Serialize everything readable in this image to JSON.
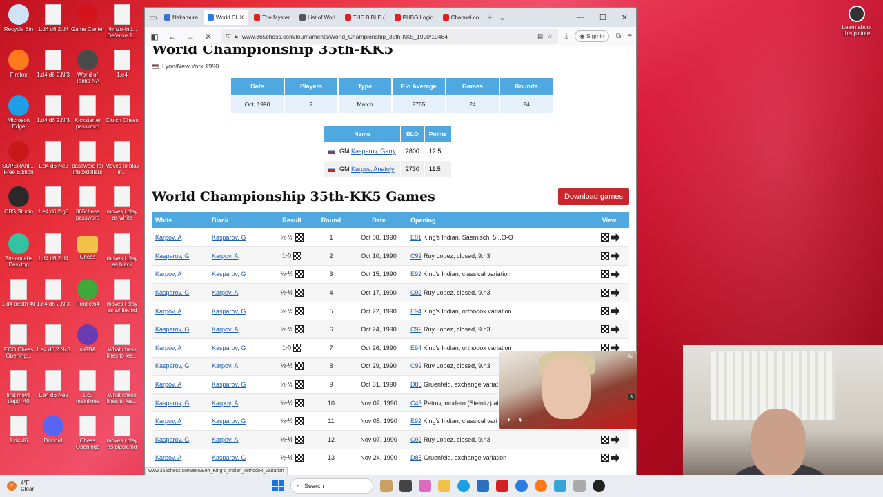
{
  "desktop": {
    "icons": [
      {
        "label": "Recycle Bin",
        "icon": "recycle-bin-icon",
        "color": "#cfe3f5"
      },
      {
        "label": "1.d4 d6 2.d4",
        "icon": "document-icon"
      },
      {
        "label": "Game Center",
        "icon": "game-center-icon",
        "color": "#d4141c"
      },
      {
        "label": "Nimzo-Ind... Defense 1...",
        "icon": "document-icon"
      },
      {
        "label": "Firefox",
        "icon": "firefox-icon",
        "color": "#ff7a1a"
      },
      {
        "label": "1.d4 d6 2.Nf3",
        "icon": "document-icon"
      },
      {
        "label": "World of Tanks NA",
        "icon": "world-of-tanks-icon",
        "color": "#4a4a4a"
      },
      {
        "label": "1.e4",
        "icon": "document-icon"
      },
      {
        "label": "Microsoft Edge",
        "icon": "edge-icon",
        "color": "#1e9ee6"
      },
      {
        "label": "1.d4 d6 2.Nf3",
        "icon": "document-icon"
      },
      {
        "label": "Kickstarter password",
        "icon": "document-icon"
      },
      {
        "label": "Clutch Chess",
        "icon": "document-icon"
      },
      {
        "label": "SUPERAnti... Free Edition",
        "icon": "superantispyware-icon",
        "color": "#c81818"
      },
      {
        "label": "1.d4 d6 Ne2",
        "icon": "document-icon"
      },
      {
        "label": "password for inboxdollars",
        "icon": "document-icon"
      },
      {
        "label": "Moves to play in...",
        "icon": "document-icon"
      },
      {
        "label": "OBS Studio",
        "icon": "obs-icon",
        "color": "#2a2a2a"
      },
      {
        "label": "1.e4 d6 2.g3",
        "icon": "document-icon"
      },
      {
        "label": "365chess password",
        "icon": "document-icon"
      },
      {
        "label": "moves i play as white",
        "icon": "document-icon"
      },
      {
        "label": "Streamlabs Desktop",
        "icon": "streamlabs-icon",
        "color": "#31c3a2"
      },
      {
        "label": "1.d4 d6 2.d4",
        "icon": "document-icon"
      },
      {
        "label": "Chess",
        "icon": "folder-icon"
      },
      {
        "label": "moves i play as black",
        "icon": "document-icon"
      },
      {
        "label": "1.d4 depth 40",
        "icon": "document-icon"
      },
      {
        "label": "1.e4 d6 2.Nf3",
        "icon": "document-icon"
      },
      {
        "label": "Project64",
        "icon": "project64-icon",
        "color": "#3fa83a"
      },
      {
        "label": "moves i play as white.md",
        "icon": "document-icon"
      },
      {
        "label": "ECO Chess Opening...",
        "icon": "document-icon"
      },
      {
        "label": "1.e4 d6 2.Nc3",
        "icon": "document-icon"
      },
      {
        "label": "mGBA",
        "icon": "mgba-icon",
        "color": "#6a3ab0"
      },
      {
        "label": "What chess lines to lea...",
        "icon": "document-icon"
      },
      {
        "label": "first move depth 40",
        "icon": "document-icon"
      },
      {
        "label": "1.e4 d6 Ne2",
        "icon": "document-icon"
      },
      {
        "label": "1.c3 mainlines",
        "icon": "document-icon"
      },
      {
        "label": "What chess lines to lea...",
        "icon": "document-icon"
      },
      {
        "label": "1.d4 d6",
        "icon": "document-icon"
      },
      {
        "label": "Discord",
        "icon": "discord-icon",
        "color": "#5865f2"
      },
      {
        "label": "Chess Openings",
        "icon": "document-icon"
      },
      {
        "label": "moves i play as black.md",
        "icon": "document-icon"
      }
    ],
    "spotlight_label": "Learn about this picture"
  },
  "browser": {
    "tabs": [
      {
        "label": "Nakamura",
        "color": "#3a6fd8",
        "active": false
      },
      {
        "label": "World Cl",
        "color": "#2a7de0",
        "active": true
      },
      {
        "label": "The Myster",
        "color": "#e02020",
        "active": false
      },
      {
        "label": "List of Worl",
        "color": "#555555",
        "active": false
      },
      {
        "label": "THE BIBLE (",
        "color": "#e02020",
        "active": false
      },
      {
        "label": "PUBG Logic",
        "color": "#e02020",
        "active": false
      },
      {
        "label": "Channel co",
        "color": "#e02020",
        "active": false
      }
    ],
    "url": "www.365chess.com/tournaments/World_Championship_35th-KK5_1990/19484",
    "signin_label": "Sign in",
    "status_url": "www.365chess.com/eco/E94_King's_Indian_orthodox_variation"
  },
  "page": {
    "title": "World Championship 35th-KK5",
    "location": "Lyon/New York 1990",
    "info": {
      "headers": [
        "Date",
        "Players",
        "Type",
        "Elo Average",
        "Games",
        "Rounds"
      ],
      "values": [
        "Oct, 1990",
        "2",
        "Match",
        "2765",
        "24",
        "24"
      ]
    },
    "players": {
      "headers": [
        "Name",
        "ELO",
        "Points"
      ],
      "rows": [
        {
          "title": "GM",
          "name": "Kasparov, Garry",
          "elo": "2800",
          "points": "12.5"
        },
        {
          "title": "GM",
          "name": "Karpov, Anatoly",
          "elo": "2730",
          "points": "11.5"
        }
      ]
    },
    "games_title": "World Championship 35th-KK5 Games",
    "download_label": "Download games",
    "games": {
      "headers": [
        "White",
        "Black",
        "Result",
        "Round",
        "Date",
        "Opening",
        "View"
      ],
      "rows": [
        {
          "white": "Karpov, A",
          "black": "Kasparov, G",
          "result": "½-½",
          "round": "1",
          "date": "Oct 08, 1990",
          "eco": "E81",
          "opening": "King's Indian, Saemisch, 5...O-O"
        },
        {
          "white": "Kasparov, G",
          "black": "Karpov, A",
          "result": "1-0",
          "round": "2",
          "date": "Oct 10, 1990",
          "eco": "C92",
          "opening": "Ruy Lopez, closed, 9.h3"
        },
        {
          "white": "Karpov, A",
          "black": "Kasparov, G",
          "result": "½-½",
          "round": "3",
          "date": "Oct 15, 1990",
          "eco": "E92",
          "opening": "King's Indian, classical variation"
        },
        {
          "white": "Kasparov, G",
          "black": "Karpov, A",
          "result": "½-½",
          "round": "4",
          "date": "Oct 17, 1990",
          "eco": "C92",
          "opening": "Ruy Lopez, closed, 9.h3"
        },
        {
          "white": "Karpov, A",
          "black": "Kasparov, G",
          "result": "½-½",
          "round": "5",
          "date": "Oct 22, 1990",
          "eco": "E94",
          "opening": "King's Indian, orthodox variation"
        },
        {
          "white": "Kasparov, G",
          "black": "Karpov, A",
          "result": "½-½",
          "round": "6",
          "date": "Oct 24, 1990",
          "eco": "C92",
          "opening": "Ruy Lopez, closed, 9.h3"
        },
        {
          "white": "Karpov, A",
          "black": "Kasparov, G",
          "result": "1-0",
          "round": "7",
          "date": "Oct 26, 1990",
          "eco": "E94",
          "opening": "King's Indian, orthodox variation"
        },
        {
          "white": "Kasparov, G",
          "black": "Karpov, A",
          "result": "½-½",
          "round": "8",
          "date": "Oct 29, 1990",
          "eco": "C92",
          "opening": "Ruy Lopez, closed, 9.h3"
        },
        {
          "white": "Karpov, A",
          "black": "Kasparov, G",
          "result": "½-½",
          "round": "9",
          "date": "Oct 31, 1990",
          "eco": "D85",
          "opening": "Gruenfeld, exchange variat"
        },
        {
          "white": "Kasparov, G",
          "black": "Karpov, A",
          "result": "½-½",
          "round": "10",
          "date": "Nov 02, 1990",
          "eco": "C43",
          "opening": "Petrov, modern (Steinitz) at"
        },
        {
          "white": "Karpov, A",
          "black": "Kasparov, G",
          "result": "½-½",
          "round": "11",
          "date": "Nov 05, 1990",
          "eco": "E92",
          "opening": "King's Indian, classical vari"
        },
        {
          "white": "Kasparov, G",
          "black": "Karpov, A",
          "result": "½-½",
          "round": "12",
          "date": "Nov 07, 1990",
          "eco": "C92",
          "opening": "Ruy Lopez, closed, 9.h3"
        },
        {
          "white": "Karpov, A",
          "black": "Kasparov, G",
          "result": "½-½",
          "round": "13",
          "date": "Nov 24, 1990",
          "eco": "D85",
          "opening": "Gruenfeld, exchange variation"
        }
      ]
    }
  },
  "video_ad": {
    "badge": "3",
    "ad_label": "Ad"
  },
  "taskbar": {
    "temperature": "4°F",
    "condition": "Clear",
    "search_placeholder": "Search",
    "weather_badge": "7"
  }
}
